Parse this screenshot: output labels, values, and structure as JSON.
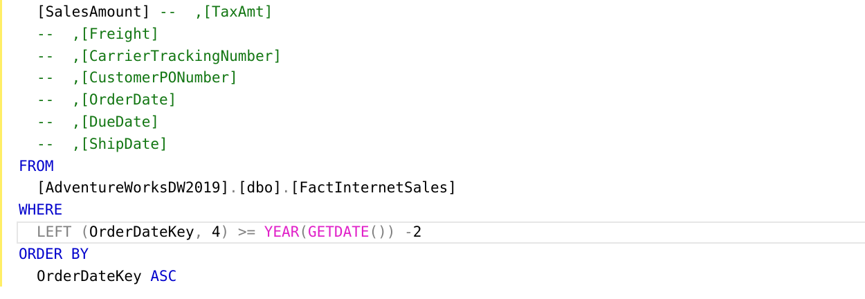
{
  "editor": {
    "lines": [
      {
        "segments": [
          {
            "text": "[SalesAmount]",
            "color": "black"
          },
          {
            "text": " --  ,[TaxAmt]",
            "color": "green"
          }
        ]
      },
      {
        "segments": [
          {
            "text": "--  ,[Freight]",
            "color": "green"
          }
        ]
      },
      {
        "segments": [
          {
            "text": "--  ,[CarrierTrackingNumber]",
            "color": "green"
          }
        ]
      },
      {
        "segments": [
          {
            "text": "--  ,[CustomerPONumber]",
            "color": "green"
          }
        ]
      },
      {
        "segments": [
          {
            "text": "--  ,[OrderDate]",
            "color": "green"
          }
        ]
      },
      {
        "segments": [
          {
            "text": "--  ,[DueDate]",
            "color": "green"
          }
        ]
      },
      {
        "segments": [
          {
            "text": "--  ,[ShipDate]",
            "color": "green"
          }
        ]
      },
      {
        "segments": [
          {
            "text": "FROM",
            "color": "blue"
          }
        ]
      },
      {
        "segments": [
          {
            "text": "[AdventureWorksDW2019]",
            "color": "black"
          },
          {
            "text": ".",
            "color": "gray"
          },
          {
            "text": "[dbo]",
            "color": "black"
          },
          {
            "text": ".",
            "color": "gray"
          },
          {
            "text": "[FactInternetSales]",
            "color": "black"
          }
        ]
      },
      {
        "segments": [
          {
            "text": "WHERE",
            "color": "blue"
          }
        ]
      },
      {
        "segments": [
          {
            "text": "LEFT",
            "color": "gray"
          },
          {
            "text": " (",
            "color": "gray"
          },
          {
            "text": "OrderDateKey",
            "color": "black"
          },
          {
            "text": ", ",
            "color": "gray"
          },
          {
            "text": "4",
            "color": "black"
          },
          {
            "text": ") >= ",
            "color": "gray"
          },
          {
            "text": "YEAR",
            "color": "pink"
          },
          {
            "text": "(",
            "color": "gray"
          },
          {
            "text": "GETDATE",
            "color": "pink"
          },
          {
            "text": "()) ",
            "color": "gray"
          },
          {
            "text": "-",
            "color": "gray"
          },
          {
            "text": "2",
            "color": "black"
          }
        ]
      },
      {
        "segments": [
          {
            "text": "ORDER BY",
            "color": "blue"
          }
        ]
      },
      {
        "segments": [
          {
            "text": "OrderDateKey",
            "color": "black"
          },
          {
            "text": " ",
            "color": "black"
          },
          {
            "text": "ASC",
            "color": "blue"
          }
        ]
      }
    ]
  },
  "colors": {
    "green": "#127612",
    "blue": "#0000cc",
    "gray": "#808080",
    "pink": "#e020c8",
    "black": "#000000",
    "gutter": "#ffee66",
    "current_line_border": "#e6e6e6"
  }
}
